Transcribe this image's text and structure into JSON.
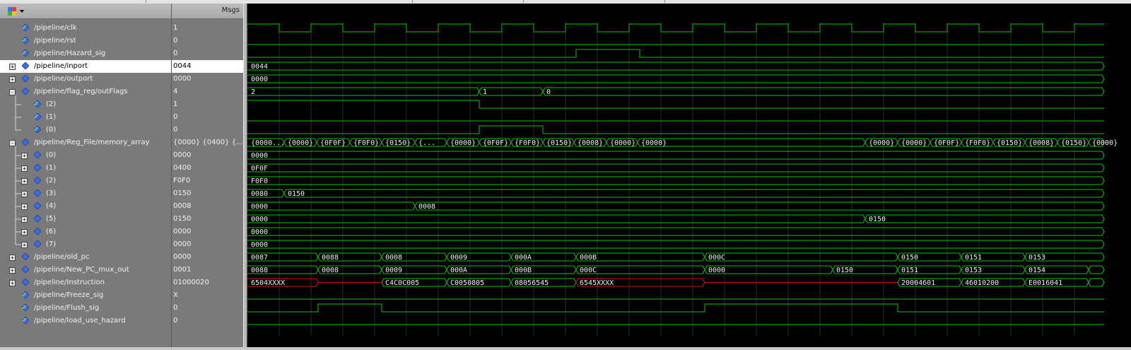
{
  "window": {
    "msgs_header": "Msgs"
  },
  "colors": {
    "wave": "#00c800",
    "bus_x": "#d01010",
    "bg": "#000000",
    "selection": "#ffffff"
  },
  "signals": [
    {
      "name": "/pipeline/clk",
      "value": "1",
      "depth": 0,
      "expand": "",
      "kind": "logic"
    },
    {
      "name": "/pipeline/rst",
      "value": "0",
      "depth": 0,
      "expand": "",
      "kind": "logic"
    },
    {
      "name": "/pipeline/Hazard_sig",
      "value": "0",
      "depth": 0,
      "expand": "",
      "kind": "logic"
    },
    {
      "name": "/pipeline/inport",
      "value": "0044",
      "depth": 0,
      "expand": "+",
      "kind": "bus",
      "selected": true
    },
    {
      "name": "/pipeline/outport",
      "value": "0000",
      "depth": 0,
      "expand": "+",
      "kind": "bus"
    },
    {
      "name": "/pipeline/flag_reg/outFlags",
      "value": "4",
      "depth": 0,
      "expand": "-",
      "kind": "bus"
    },
    {
      "name": "(2)",
      "value": "1",
      "depth": 1,
      "expand": "",
      "kind": "logic"
    },
    {
      "name": "(1)",
      "value": "0",
      "depth": 1,
      "expand": "",
      "kind": "logic"
    },
    {
      "name": "(0)",
      "value": "0",
      "depth": 1,
      "expand": "",
      "kind": "logic"
    },
    {
      "name": "/pipeline/Reg_File/memory_array",
      "value": "{0000} {0400} {...",
      "depth": 0,
      "expand": "-",
      "kind": "bus"
    },
    {
      "name": "(0)",
      "value": "0000",
      "depth": 1,
      "expand": "+",
      "kind": "bus"
    },
    {
      "name": "(1)",
      "value": "0400",
      "depth": 1,
      "expand": "+",
      "kind": "bus"
    },
    {
      "name": "(2)",
      "value": "F0F0",
      "depth": 1,
      "expand": "+",
      "kind": "bus"
    },
    {
      "name": "(3)",
      "value": "0150",
      "depth": 1,
      "expand": "+",
      "kind": "bus"
    },
    {
      "name": "(4)",
      "value": "0008",
      "depth": 1,
      "expand": "+",
      "kind": "bus"
    },
    {
      "name": "(5)",
      "value": "0150",
      "depth": 1,
      "expand": "+",
      "kind": "bus"
    },
    {
      "name": "(6)",
      "value": "0000",
      "depth": 1,
      "expand": "+",
      "kind": "bus"
    },
    {
      "name": "(7)",
      "value": "0000",
      "depth": 1,
      "expand": "+",
      "kind": "bus"
    },
    {
      "name": "/pipeline/old_pc",
      "value": "0000",
      "depth": 0,
      "expand": "+",
      "kind": "bus"
    },
    {
      "name": "/pipeline/New_PC_mux_out",
      "value": "0001",
      "depth": 0,
      "expand": "+",
      "kind": "bus"
    },
    {
      "name": "/pipeline/Instruction",
      "value": "01000020",
      "depth": 0,
      "expand": "+",
      "kind": "bus"
    },
    {
      "name": "/pipeline/Freeze_sig",
      "value": "X",
      "depth": 0,
      "expand": "",
      "kind": "logic"
    },
    {
      "name": "/pipeline/Flush_sig",
      "value": "0",
      "depth": 0,
      "expand": "",
      "kind": "logic"
    },
    {
      "name": "/pipeline/load_use_hazard",
      "value": "0",
      "depth": 0,
      "expand": "",
      "kind": "logic"
    }
  ],
  "bus_labels": {
    "inport": [
      "0044"
    ],
    "outport": [
      "0000"
    ],
    "outFlags": [
      "2",
      "1",
      "0"
    ],
    "memory_array": [
      "{0000...",
      "{0000}",
      "{0F0F}",
      "{F0F0}",
      "{0150}",
      "{...",
      "{0000}",
      "{0F0F}",
      "{F0F0}",
      "{0150}",
      "{0008}",
      "{0000}",
      "{0000}",
      "{0000}",
      "{0000}",
      "{0F0F}",
      "{F0F0}",
      "{0150}",
      "{0008}",
      "{0150}",
      "{0000}",
      "{0000}"
    ],
    "mem0": [
      "0000"
    ],
    "mem1": [
      "0F0F"
    ],
    "mem2": [
      "F0F0"
    ],
    "mem3": [
      "0080",
      "0150"
    ],
    "mem4": [
      "0000",
      "0008"
    ],
    "mem5": [
      "0000",
      "0150"
    ],
    "mem6": [
      "0000"
    ],
    "mem7": [
      "0000"
    ],
    "old_pc": [
      "0087",
      "0088",
      "0008",
      "0009",
      "000A",
      "000B",
      "000C",
      "0150",
      "0151",
      "0153"
    ],
    "new_pc": [
      "0088",
      "0008",
      "0009",
      "000A",
      "000B",
      "000C",
      "0000",
      "0150",
      "0151",
      "0153",
      "0154"
    ],
    "instruction": [
      "6504XXXX",
      "C4C0C005",
      "C0050805",
      "08056545",
      "6545XXXX",
      "20004601",
      "46010200",
      "E0016041"
    ]
  }
}
